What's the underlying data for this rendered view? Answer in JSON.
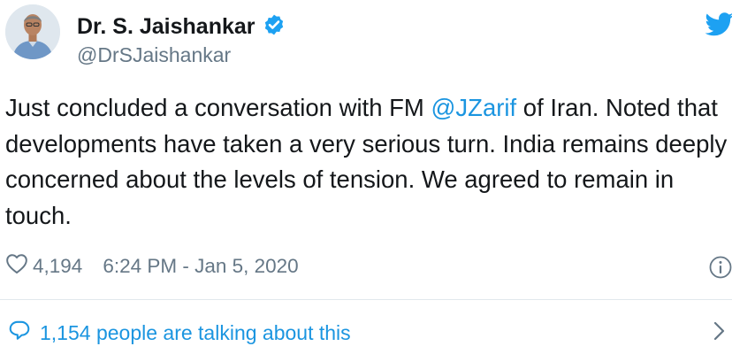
{
  "user": {
    "name": "Dr. S. Jaishankar",
    "handle": "@DrSJaishankar",
    "verified": true
  },
  "tweet": {
    "text_before": "Just concluded a conversation with FM ",
    "mention": "@JZarif",
    "text_after": " of Iran. Noted that developments have taken a very serious turn. India remains deeply concerned about the levels of tension. We agreed to remain in touch."
  },
  "meta": {
    "likes": "4,194",
    "timestamp": "6:24 PM - Jan 5, 2020"
  },
  "footer": {
    "talking": "1,154 people are talking about this"
  },
  "icons": {
    "brand": "twitter-bird-icon",
    "verified": "verified-badge-icon",
    "like": "heart-outline-icon",
    "info": "info-icon",
    "reply": "speech-bubble-icon",
    "chevron": "chevron-right-icon"
  },
  "colors": {
    "brand": "#1da1f2",
    "link": "#1b95e0",
    "text": "#14171a",
    "muted": "#657786",
    "divider": "#e1e8ed"
  }
}
